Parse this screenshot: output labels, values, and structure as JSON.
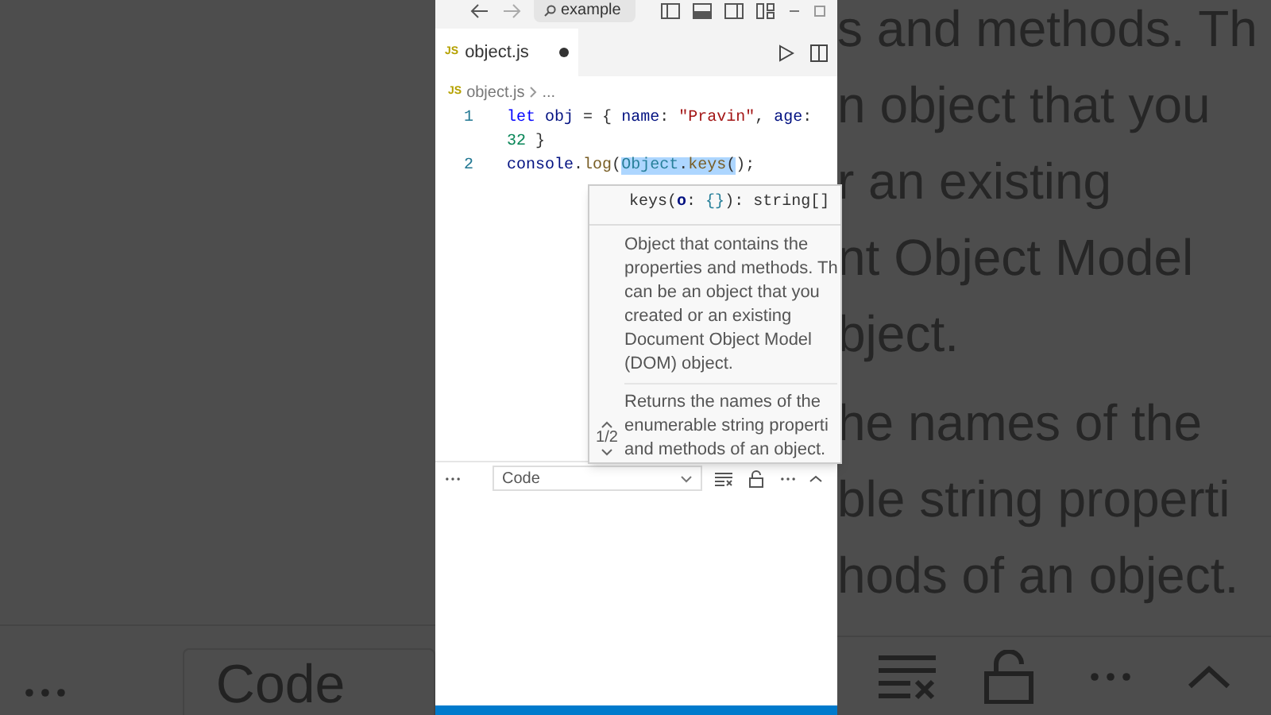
{
  "background_left": {
    "field_value": "Code"
  },
  "background_right": {
    "lines": [
      "s and methods. Th",
      "n object that you",
      "r an existing",
      "nt Object Model",
      "bject.",
      "he names of the",
      "ble string properti",
      "hods of an object."
    ]
  },
  "title_bar": {
    "search": "example"
  },
  "tabs": [
    {
      "icon": "JS",
      "label": "object.js",
      "selected": true,
      "modified": true
    }
  ],
  "breadcrumb": {
    "icon": "JS",
    "file": "object.js",
    "rest": "..."
  },
  "editor": {
    "lines": [
      {
        "number": "1",
        "rows": [
          [
            {
              "kind": "keyword",
              "text": "let"
            },
            {
              "kind": "plain",
              "text": " "
            },
            {
              "kind": "variable",
              "text": "obj"
            },
            {
              "kind": "plain",
              "text": " = { "
            },
            {
              "kind": "variable",
              "text": "name"
            },
            {
              "kind": "plain",
              "text": ": "
            },
            {
              "kind": "string",
              "text": "\"Pravin\""
            },
            {
              "kind": "plain",
              "text": ", "
            },
            {
              "kind": "variable",
              "text": "age"
            },
            {
              "kind": "plain",
              "text": ":"
            }
          ],
          [
            {
              "kind": "number",
              "text": "32"
            },
            {
              "kind": "plain",
              "text": " }"
            }
          ]
        ]
      },
      {
        "number": "2",
        "rows": [
          [
            {
              "kind": "variable",
              "text": "console"
            },
            {
              "kind": "plain",
              "text": "."
            },
            {
              "kind": "function",
              "text": "log"
            },
            {
              "kind": "plain",
              "text": "("
            },
            {
              "kind": "type",
              "text": "Object",
              "highlighted": true
            },
            {
              "kind": "plain",
              "text": ".",
              "highlighted": true
            },
            {
              "kind": "function",
              "text": "keys",
              "highlighted": true
            },
            {
              "kind": "plain",
              "text": "(",
              "highlighted": true
            },
            {
              "kind": "plain",
              "text": ");"
            }
          ]
        ]
      }
    ]
  },
  "hover": {
    "signature": [
      {
        "kind": "plain",
        "text": "keys("
      },
      {
        "kind": "param",
        "text": "o"
      },
      {
        "kind": "plain",
        "text": ": "
      },
      {
        "kind": "type",
        "text": "{}"
      },
      {
        "kind": "plain",
        "text": "): string[]"
      }
    ],
    "paragraphs": [
      [
        "Object that contains the",
        "properties and methods. Th",
        "can be an object that you",
        "created or an existing",
        "Document Object Model",
        "(DOM) object."
      ],
      [
        "Returns the names of the",
        "enumerable string properti",
        "and methods of an object."
      ]
    ],
    "pager": "1/2"
  },
  "panel": {
    "dropdown": "Code"
  }
}
